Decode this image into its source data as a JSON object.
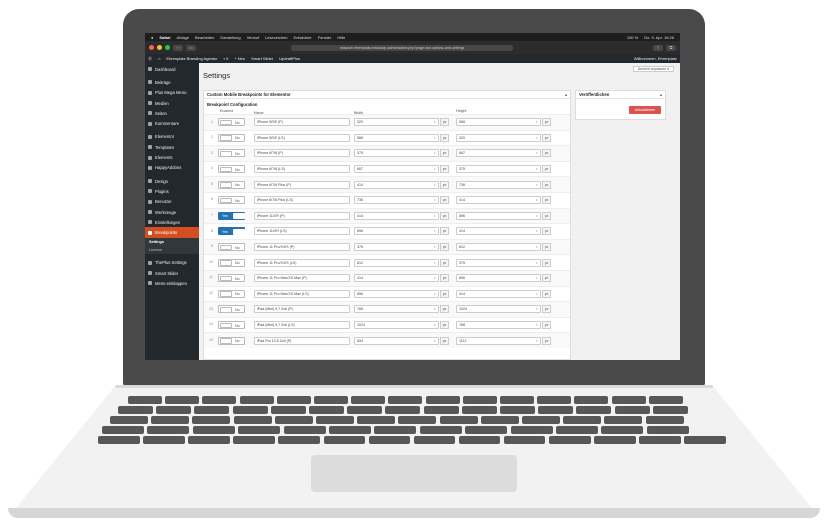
{
  "menubar": {
    "apple": "",
    "items": [
      "Safari",
      "Ablage",
      "Bearbeiten",
      "Darstellung",
      "Verlauf",
      "Lesezeichen",
      "Entwickler",
      "Fenster",
      "Hilfe"
    ],
    "battery": "100 %",
    "clock": "Do. 9. Apr.  16:26"
  },
  "browser": {
    "url": "relaunch.ehrenplatz.media/wp-admin/admin.php?page=acf-options-cmb-settings"
  },
  "adminbar": {
    "site_name": "Ehrenplatz Branding Agentur",
    "comments": "0",
    "new_label": "Neu",
    "smart_slider": "Smart Slider",
    "updraft": "UpdraftPlus",
    "greeting": "Willkommen, Ehrenplatz"
  },
  "sidebar": {
    "items": [
      {
        "label": "Dashboard"
      },
      {
        "label": "Beiträge"
      },
      {
        "label": "Plus Mega Menu"
      },
      {
        "label": "Medien"
      },
      {
        "label": "Seiten"
      },
      {
        "label": "Kommentare"
      },
      {
        "label": "Elementor"
      },
      {
        "label": "Templates"
      },
      {
        "label": "Elements"
      },
      {
        "label": "HappyAddons"
      },
      {
        "label": "Design"
      },
      {
        "label": "Plugins"
      },
      {
        "label": "Benutzer"
      },
      {
        "label": "Werkzeuge"
      },
      {
        "label": "Einstellungen"
      },
      {
        "label": "Breakpoints"
      }
    ],
    "submenu": [
      "Settings",
      "License"
    ],
    "bottom_items": [
      {
        "label": "ThePlus Settings"
      },
      {
        "label": "Smart Slider"
      },
      {
        "label": "Menü einklappen"
      }
    ]
  },
  "main": {
    "view_button": "Ansicht anpassen ▾",
    "title": "Settings",
    "box_title": "Custom Mobile Breakpoints for Elementor",
    "section_title": "Breakpoint Configuration",
    "columns": {
      "enabled": "Enabled",
      "name": "Name",
      "width": "Width",
      "height": "Height",
      "required_mark": "*"
    },
    "unit": "px",
    "rows": [
      {
        "n": "1",
        "enabled": false,
        "toggle": "No",
        "name": "iPhone 5/SE (P)",
        "width": "320",
        "height": "568"
      },
      {
        "n": "2",
        "enabled": false,
        "toggle": "No",
        "name": "iPhone 5/SE (LS)",
        "width": "568",
        "height": "320"
      },
      {
        "n": "3",
        "enabled": false,
        "toggle": "No",
        "name": "iPhone 6/7/8 (P)",
        "width": "375",
        "height": "667"
      },
      {
        "n": "4",
        "enabled": false,
        "toggle": "No",
        "name": "iPhone 6/7/8 (LS)",
        "width": "667",
        "height": "375"
      },
      {
        "n": "5",
        "enabled": false,
        "toggle": "No",
        "name": "iPhone 6/7/8 Plus (P)",
        "width": "414",
        "height": "736"
      },
      {
        "n": "6",
        "enabled": false,
        "toggle": "No",
        "name": "iPhone 6/7/8 Plus (LS)",
        "width": "736",
        "height": "414"
      },
      {
        "n": "7",
        "enabled": true,
        "toggle": "Yes",
        "name": "iPhone 11/XR (P)",
        "width": "414",
        "height": "896"
      },
      {
        "n": "8",
        "enabled": true,
        "toggle": "Yes",
        "name": "iPhone 11/XR (LS)",
        "width": "896",
        "height": "414"
      },
      {
        "n": "9",
        "enabled": false,
        "toggle": "No",
        "name": "iPhone 11 Pro/X/XS (P)",
        "width": "375",
        "height": "812"
      },
      {
        "n": "10",
        "enabled": false,
        "toggle": "No",
        "name": "iPhone 11 Pro/X/XS (LS)",
        "width": "812",
        "height": "375"
      },
      {
        "n": "11",
        "enabled": false,
        "toggle": "No",
        "name": "iPhone 11 Pro Max/XS Max (P)",
        "width": "414",
        "height": "896"
      },
      {
        "n": "12",
        "enabled": false,
        "toggle": "No",
        "name": "iPhone 11 Pro Max/XS Max (LS)",
        "width": "896",
        "height": "414"
      },
      {
        "n": "13",
        "enabled": false,
        "toggle": "No",
        "name": "iPad (Mini) 9,7 Zoll (P)",
        "width": "768",
        "height": "1024"
      },
      {
        "n": "14",
        "enabled": false,
        "toggle": "No",
        "name": "iPad (Mini) 9,7 Zoll (LS)",
        "width": "1024",
        "height": "768"
      },
      {
        "n": "15",
        "enabled": false,
        "toggle": "No",
        "name": "iPad Pro 10,5 Zoll (P)",
        "width": "834",
        "height": "1112"
      }
    ]
  },
  "publish": {
    "title": "Veröffentlichen",
    "button": "Aktualisieren"
  },
  "colors": {
    "accent_blue": "#2271b1",
    "active_menu": "#d54e21",
    "publish_button": "#d9534f",
    "sidebar_bg": "#23282d"
  }
}
